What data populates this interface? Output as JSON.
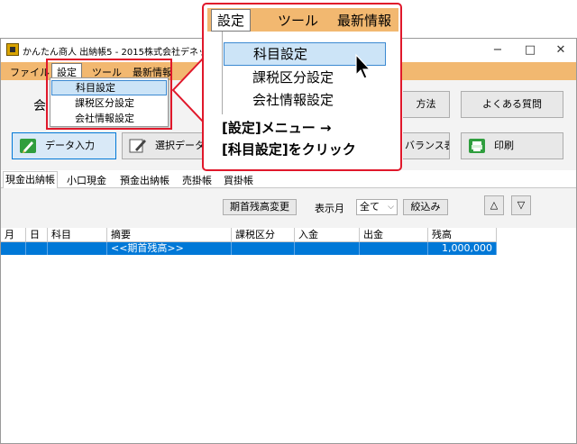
{
  "window": {
    "title": "かんたん商人 出納帳5 - 2015株式会社デネット.su5",
    "minimize": "−",
    "maximize": "□",
    "close": "✕"
  },
  "menubar": {
    "items": [
      "ファイル",
      "設定",
      "ツール",
      "最新情報"
    ]
  },
  "settings_menu": {
    "items": [
      "科目設定",
      "課税区分設定",
      "会社情報設定"
    ],
    "selected_index": 0
  },
  "toolbar": {
    "partial_left": "会",
    "partial_dot": "・",
    "howto_partial": "方法",
    "faq": "よくある質問",
    "data_entry": "データ入力",
    "select_data_partial": "選択データ",
    "balance_partial": "バランス表",
    "print": "印刷"
  },
  "tabs": [
    "現金出納帳",
    "小口現金",
    "預金出納帳",
    "売掛帳",
    "買掛帳"
  ],
  "filterbar": {
    "opening_balance_button": "期首残高変更",
    "display_month_label": "表示月",
    "month_value": "全て",
    "narrow_button": "絞込み",
    "up_glyph": "△",
    "down_glyph": "▽"
  },
  "grid": {
    "headers": [
      "月",
      "日",
      "科目",
      "摘要",
      "課税区分",
      "入金",
      "出金",
      "残高"
    ],
    "rows": [
      {
        "month": "",
        "day": "",
        "account": "",
        "summary": "<<期首残高>>",
        "tax": "",
        "in": "",
        "out": "",
        "balance": "1,000,000"
      }
    ]
  },
  "callout": {
    "menu_items": [
      "設定",
      "ツール",
      "最新情報"
    ],
    "dropdown_items": [
      "科目設定",
      "課税区分設定",
      "会社情報設定"
    ],
    "line1": "[設定]メニュー →",
    "line2": "[科目設定]をクリック"
  },
  "colors": {
    "menubar": "#f2b870",
    "highlight": "#cce4f7",
    "selected_row": "#0078d7",
    "callout_border": "#e0182b"
  }
}
